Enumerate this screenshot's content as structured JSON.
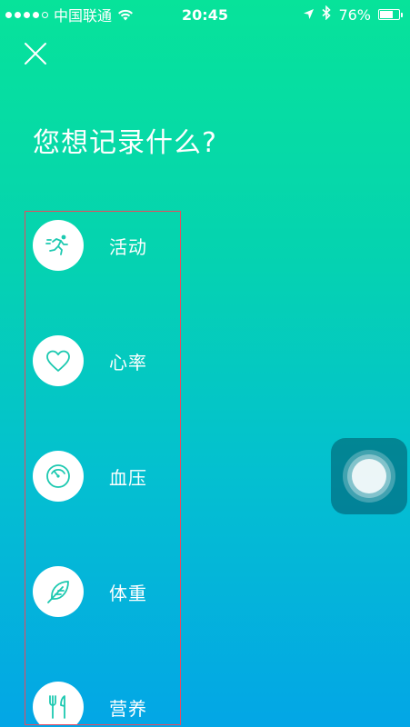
{
  "status_bar": {
    "carrier": "中国联通",
    "time": "20:45",
    "battery_text": "76%",
    "battery_level": 0.76,
    "signal_bars": 4,
    "signal_total": 5
  },
  "header": {
    "title": "您想记录什么?"
  },
  "options": [
    {
      "label": "活动",
      "icon": "running-icon"
    },
    {
      "label": "心率",
      "icon": "heart-icon"
    },
    {
      "label": "血压",
      "icon": "gauge-icon"
    },
    {
      "label": "体重",
      "icon": "feather-icon"
    },
    {
      "label": "营养",
      "icon": "fork-knife-icon"
    }
  ],
  "colors": {
    "gradient_top": "#07e39a",
    "gradient_bottom": "#03a6e6",
    "icon_color": "#1cc9b0",
    "highlight_border": "#e84a5f"
  }
}
